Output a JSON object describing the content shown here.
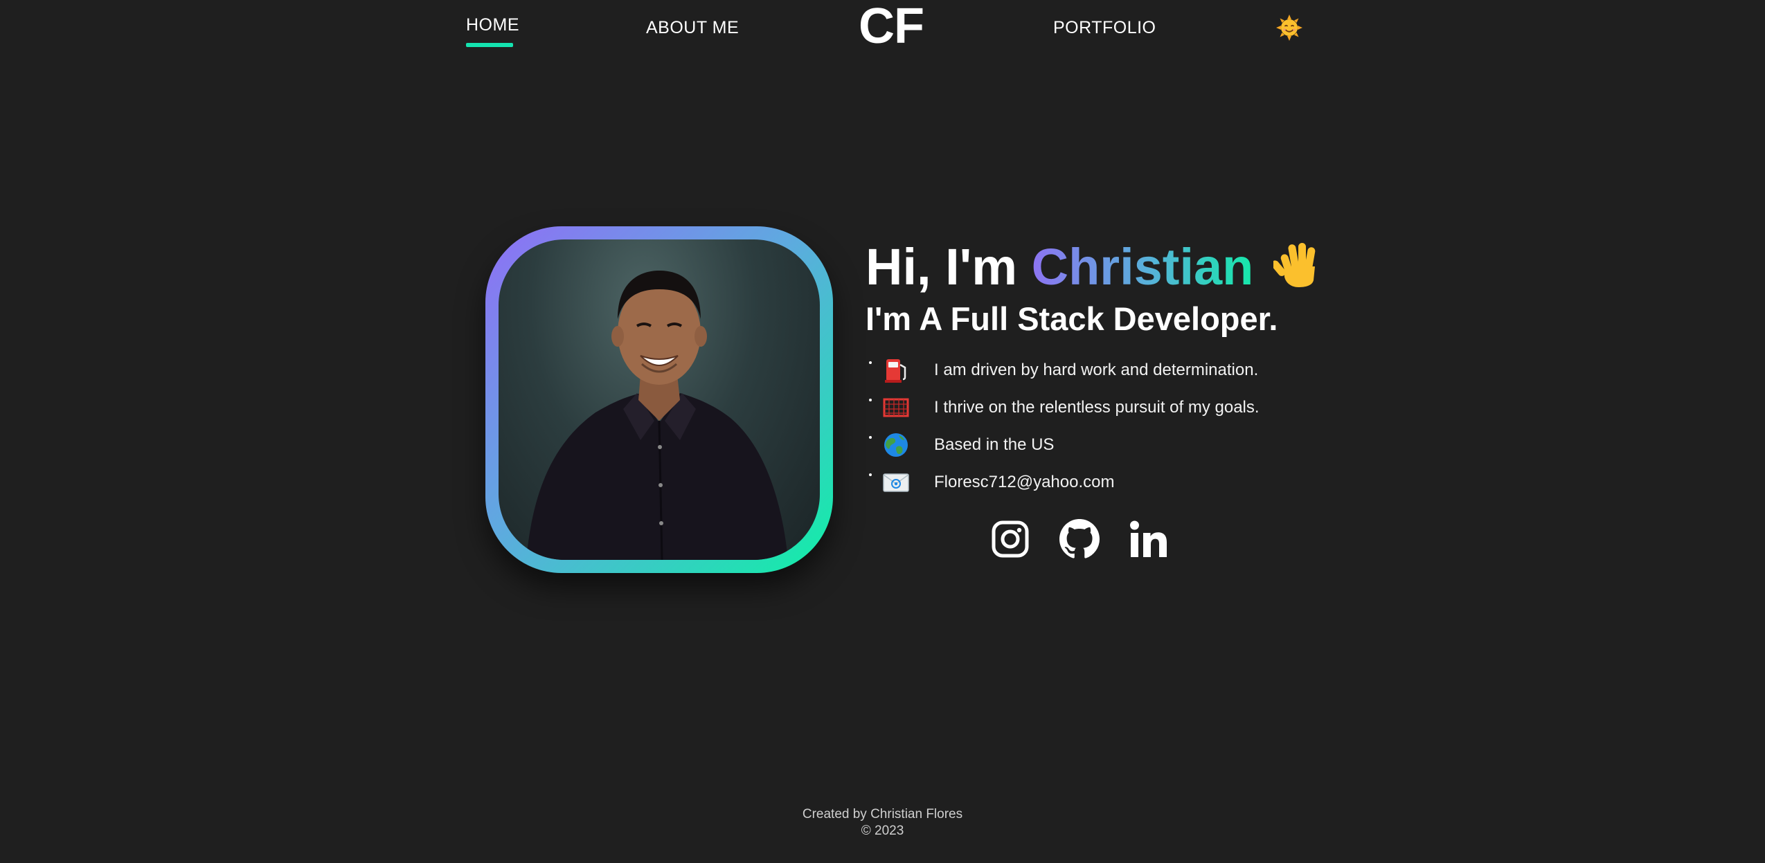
{
  "nav": {
    "home": "HOME",
    "about": "ABOUT ME",
    "logo": "CF",
    "portfolio": "PORTFOLIO",
    "theme_icon": "sun-face-icon",
    "active_color": "#14e3b0"
  },
  "hero": {
    "greeting_prefix": "Hi, I'm ",
    "name": "Christian",
    "wave_icon": "waving-hand-icon",
    "subtitle": "I'm A Full Stack Developer.",
    "facts": [
      {
        "icon": "fuel-pump-icon",
        "text": "I am driven by hard work and determination."
      },
      {
        "icon": "goal-net-icon",
        "text": "I thrive on the relentless pursuit of my goals."
      },
      {
        "icon": "globe-icon",
        "text": "Based in the US"
      },
      {
        "icon": "email-envelope-icon",
        "text": "Floresc712@yahoo.com"
      }
    ],
    "socials": [
      "instagram-icon",
      "github-icon",
      "linkedin-icon"
    ],
    "gradient": [
      "#8f6ff5",
      "#5fa9e0",
      "#10f0a6"
    ]
  },
  "footer": {
    "credit": "Created by Christian Flores",
    "copyright": "© 2023"
  }
}
